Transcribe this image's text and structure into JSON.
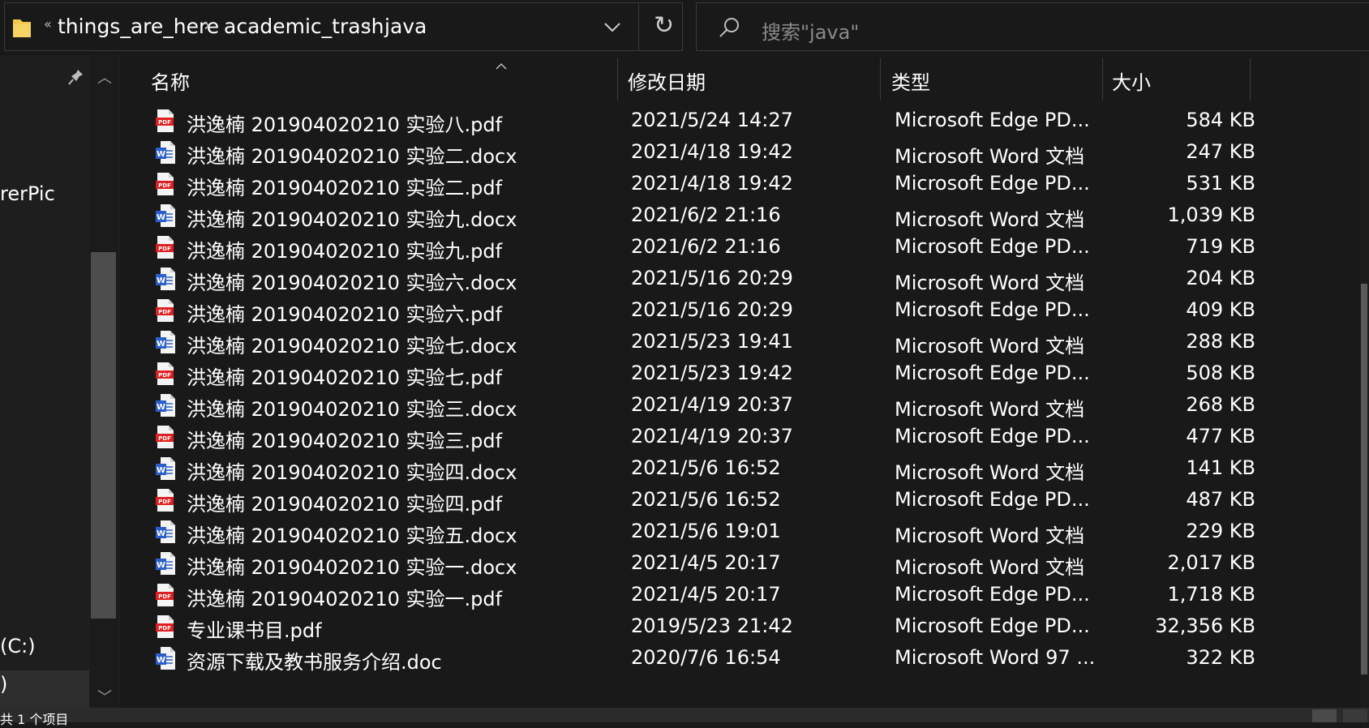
{
  "address": {
    "crumbs": [
      "things_are_here",
      "academic_trash",
      "java"
    ],
    "more": "«"
  },
  "search": {
    "placeholder": "搜索\"java\""
  },
  "nav": {
    "items": [
      "rerPic",
      "(C:)",
      ")"
    ]
  },
  "columns": {
    "name": "名称",
    "date": "修改日期",
    "type": "类型",
    "size": "大小"
  },
  "files": [
    {
      "name": "洪逸楠 201904020210 实验八.pdf",
      "date": "2021/5/24 14:27",
      "type": "Microsoft Edge PD...",
      "size": "584 KB",
      "icon": "pdf-icon"
    },
    {
      "name": "洪逸楠 201904020210 实验二.docx",
      "date": "2021/4/18 19:42",
      "type": "Microsoft Word 文档",
      "size": "247 KB",
      "icon": "word-icon"
    },
    {
      "name": "洪逸楠 201904020210 实验二.pdf",
      "date": "2021/4/18 19:42",
      "type": "Microsoft Edge PD...",
      "size": "531 KB",
      "icon": "pdf-icon"
    },
    {
      "name": "洪逸楠 201904020210 实验九.docx",
      "date": "2021/6/2 21:16",
      "type": "Microsoft Word 文档",
      "size": "1,039 KB",
      "icon": "word-icon"
    },
    {
      "name": "洪逸楠 201904020210 实验九.pdf",
      "date": "2021/6/2 21:16",
      "type": "Microsoft Edge PD...",
      "size": "719 KB",
      "icon": "pdf-icon"
    },
    {
      "name": "洪逸楠 201904020210 实验六.docx",
      "date": "2021/5/16 20:29",
      "type": "Microsoft Word 文档",
      "size": "204 KB",
      "icon": "word-icon"
    },
    {
      "name": "洪逸楠 201904020210 实验六.pdf",
      "date": "2021/5/16 20:29",
      "type": "Microsoft Edge PD...",
      "size": "409 KB",
      "icon": "pdf-icon"
    },
    {
      "name": "洪逸楠 201904020210 实验七.docx",
      "date": "2021/5/23 19:41",
      "type": "Microsoft Word 文档",
      "size": "288 KB",
      "icon": "word-icon"
    },
    {
      "name": "洪逸楠 201904020210 实验七.pdf",
      "date": "2021/5/23 19:42",
      "type": "Microsoft Edge PD...",
      "size": "508 KB",
      "icon": "pdf-icon"
    },
    {
      "name": "洪逸楠 201904020210 实验三.docx",
      "date": "2021/4/19 20:37",
      "type": "Microsoft Word 文档",
      "size": "268 KB",
      "icon": "word-icon"
    },
    {
      "name": "洪逸楠 201904020210 实验三.pdf",
      "date": "2021/4/19 20:37",
      "type": "Microsoft Edge PD...",
      "size": "477 KB",
      "icon": "pdf-icon"
    },
    {
      "name": "洪逸楠 201904020210 实验四.docx",
      "date": "2021/5/6 16:52",
      "type": "Microsoft Word 文档",
      "size": "141 KB",
      "icon": "word-icon"
    },
    {
      "name": "洪逸楠 201904020210 实验四.pdf",
      "date": "2021/5/6 16:52",
      "type": "Microsoft Edge PD...",
      "size": "487 KB",
      "icon": "pdf-icon"
    },
    {
      "name": "洪逸楠 201904020210 实验五.docx",
      "date": "2021/5/6 19:01",
      "type": "Microsoft Word 文档",
      "size": "229 KB",
      "icon": "word-icon"
    },
    {
      "name": "洪逸楠 201904020210 实验一.docx",
      "date": "2021/4/5 20:17",
      "type": "Microsoft Word 文档",
      "size": "2,017 KB",
      "icon": "word-icon"
    },
    {
      "name": "洪逸楠 201904020210 实验一.pdf",
      "date": "2021/4/5 20:17",
      "type": "Microsoft Edge PD...",
      "size": "1,718 KB",
      "icon": "pdf-icon"
    },
    {
      "name": "专业课书目.pdf",
      "date": "2019/5/23 21:42",
      "type": "Microsoft Edge PD...",
      "size": "32,356 KB",
      "icon": "pdf-icon"
    },
    {
      "name": "资源下载及教书服务介绍.doc",
      "date": "2020/7/6 16:54",
      "type": "Microsoft Word 97 ...",
      "size": "322 KB",
      "icon": "word-icon"
    }
  ],
  "status": {
    "text": "共 1 个项目"
  },
  "colors": {
    "background": "#191919",
    "pdf_red": "#e02020",
    "word_blue": "#2b5fc9"
  }
}
